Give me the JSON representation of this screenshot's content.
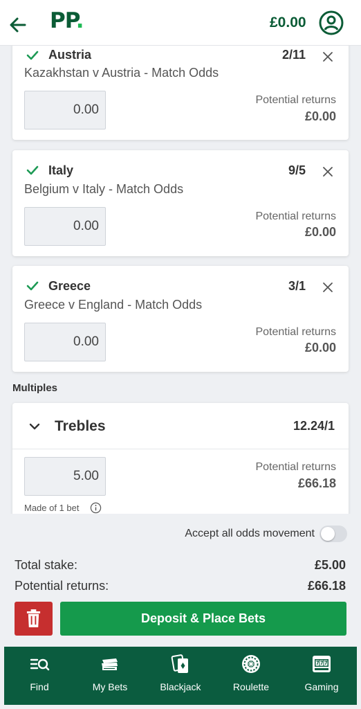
{
  "header": {
    "logo_text": "PP",
    "logo_dot": ".",
    "balance": "£0.00"
  },
  "singles": [
    {
      "selection": "Austria",
      "event": "Kazakhstan v Austria - Match Odds",
      "odds": "2/11",
      "stake": "0.00",
      "returns_label": "Potential returns",
      "returns": "£0.00"
    },
    {
      "selection": "Italy",
      "event": "Belgium v Italy - Match Odds",
      "odds": "9/5",
      "stake": "0.00",
      "returns_label": "Potential returns",
      "returns": "£0.00"
    },
    {
      "selection": "Greece",
      "event": "Greece v England - Match Odds",
      "odds": "3/1",
      "stake": "0.00",
      "returns_label": "Potential returns",
      "returns": "£0.00"
    }
  ],
  "multiples": {
    "title": "Multiples",
    "bet_type": "Trebles",
    "odds": "12.24/1",
    "stake": "5.00",
    "returns_label": "Potential returns",
    "returns": "£66.18",
    "made_of": "Made of 1 bet"
  },
  "footer": {
    "accept_odds_label": "Accept all odds movement",
    "accept_odds_on": false,
    "total_stake_label": "Total stake:",
    "total_stake": "£5.00",
    "potential_returns_label": "Potential returns:",
    "potential_returns": "£66.18",
    "place_button": "Deposit & Place Bets"
  },
  "nav": [
    {
      "label": "Find",
      "icon": "search-list-icon"
    },
    {
      "label": "My Bets",
      "icon": "tickets-icon"
    },
    {
      "label": "Blackjack",
      "icon": "playing-cards-icon"
    },
    {
      "label": "Roulette",
      "icon": "roulette-wheel-icon"
    },
    {
      "label": "Gaming",
      "icon": "slot-machine-icon"
    }
  ],
  "colors": {
    "brand_green": "#0b5c36",
    "accent_green": "#1db954",
    "button_green": "#159a4c",
    "delete_red": "#c62f2f",
    "nav_bg": "#0b5c3f"
  }
}
